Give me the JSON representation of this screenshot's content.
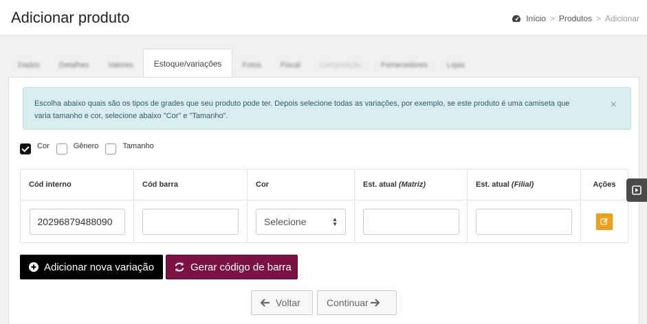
{
  "header": {
    "title": "Adicionar produto",
    "breadcrumb": {
      "home": "Início",
      "sep": ">",
      "products": "Produtos",
      "current": "Adicionar"
    }
  },
  "tabs": [
    {
      "label": "Dados"
    },
    {
      "label": "Detalhes"
    },
    {
      "label": "Valores"
    },
    {
      "label": "Estoque/variações"
    },
    {
      "label": "Fotos"
    },
    {
      "label": "Fiscal"
    },
    {
      "label": "Composição"
    },
    {
      "label": "Fornecedores"
    },
    {
      "label": "Lojas"
    }
  ],
  "alert": {
    "text": "Escolha abaixo quais são os tipos de grades que seu produto pode ter. Depois selecione todas as variações, por exemplo, se este produto é uma camiseta que varia tamanho e cor, selecione abaixo \"Cor\" e \"Tamanho\".",
    "close": "×"
  },
  "grade_options": [
    {
      "label": "Cor",
      "checked": true
    },
    {
      "label": "Gênero",
      "checked": false
    },
    {
      "label": "Tamanho",
      "checked": false
    }
  ],
  "table": {
    "headers": {
      "cod_interno": "Cód interno",
      "cod_barra": "Cód barra",
      "cor": "Cor",
      "est_matriz": "Est. atual",
      "est_matriz_em": "(Matriz)",
      "est_filial": "Est. atual",
      "est_filial_em": "(Filial)",
      "acoes": "Ações"
    },
    "row": {
      "cod_interno": "20296879488090",
      "cod_barra": "",
      "cor": "Selecione",
      "est_matriz": "",
      "est_filial": ""
    }
  },
  "buttons": {
    "add_variation": "Adicionar nova variação",
    "gen_barcode": "Gerar código de barra",
    "back": "Voltar",
    "next": "Continuar"
  },
  "colors": {
    "alert_bg": "#d9edf1",
    "barcode_btn": "#7b1145",
    "edit_btn": "#f0a11a"
  }
}
